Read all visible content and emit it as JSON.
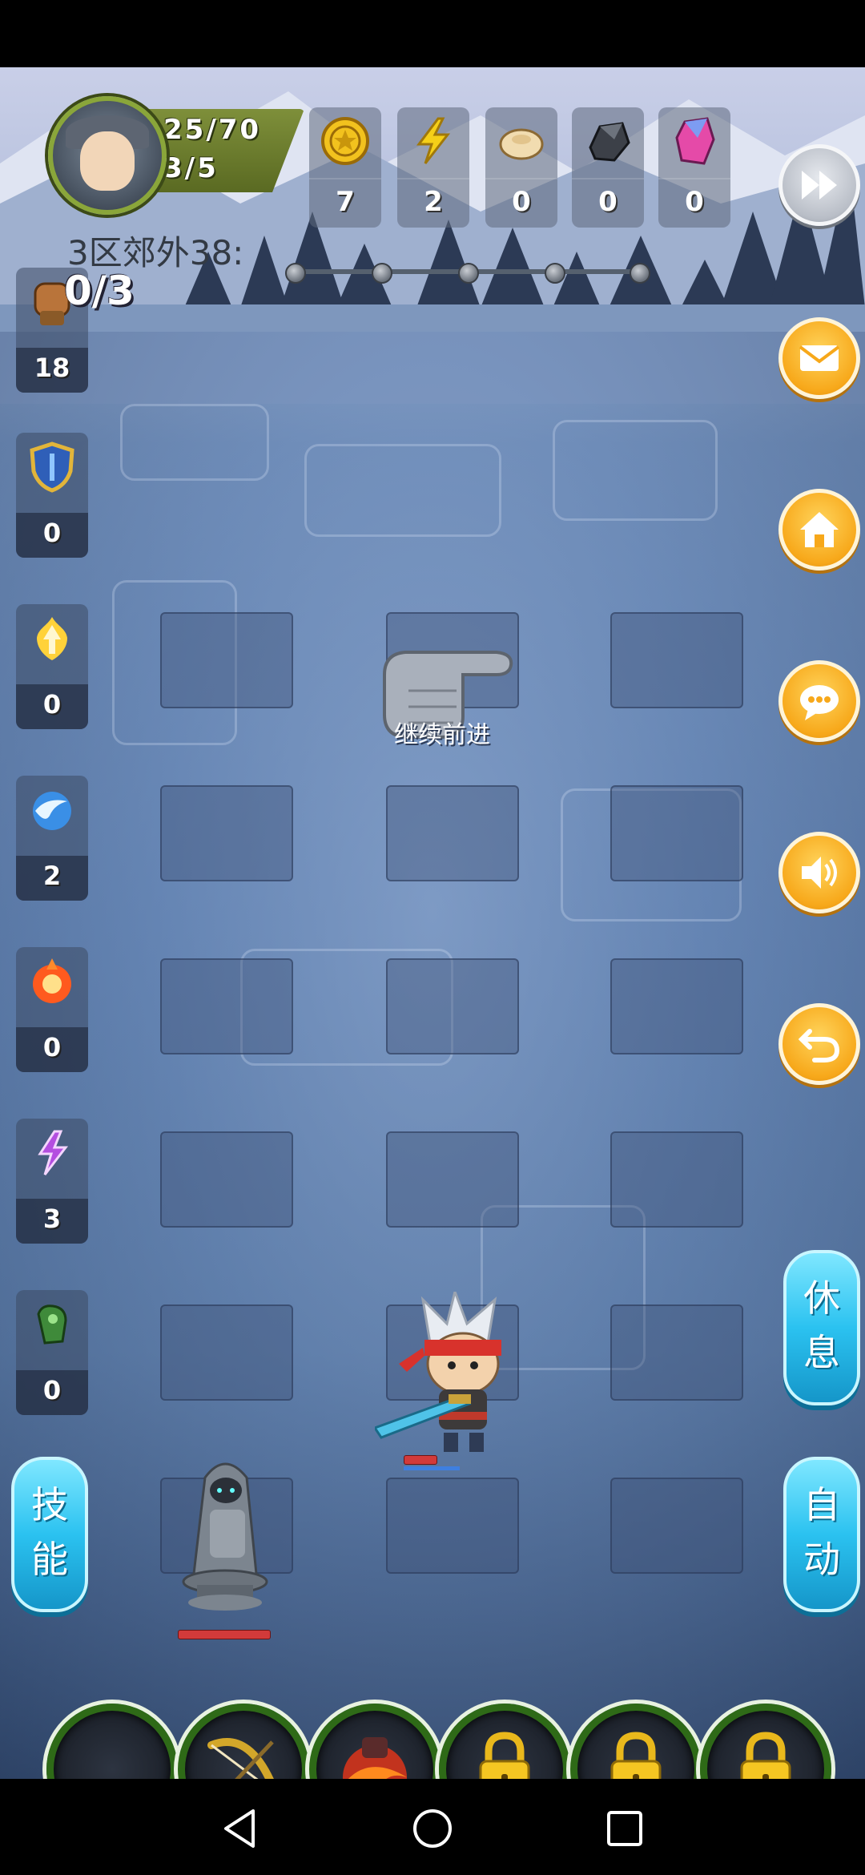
{
  "player": {
    "hp": "25/70",
    "stamina": "3/5"
  },
  "resources": [
    {
      "name": "gold-coin",
      "count": "7"
    },
    {
      "name": "lightning",
      "count": "2"
    },
    {
      "name": "dumpling",
      "count": "0"
    },
    {
      "name": "iron-ore",
      "count": "0"
    },
    {
      "name": "crystal",
      "count": "0"
    }
  ],
  "stage": {
    "label": "3区郊外38:",
    "kills": "0/3",
    "progress_steps": 5
  },
  "items": [
    {
      "name": "fist",
      "count": "18"
    },
    {
      "name": "shield",
      "count": "0"
    },
    {
      "name": "holy-arrow",
      "count": "0"
    },
    {
      "name": "water-orb",
      "count": "2"
    },
    {
      "name": "fire-orb",
      "count": "0"
    },
    {
      "name": "lightning-rune",
      "count": "3"
    },
    {
      "name": "green-gauntlet",
      "count": "0"
    }
  ],
  "side_buttons": [
    "fast-forward",
    "mail",
    "home",
    "chat",
    "sound",
    "back"
  ],
  "actions": {
    "rest": "休息",
    "auto": "自动",
    "skill": "技能"
  },
  "hint": "继续前进",
  "skills": [
    {
      "name": "empty"
    },
    {
      "name": "bow"
    },
    {
      "name": "fire-strike"
    },
    {
      "name": "locked"
    },
    {
      "name": "locked"
    },
    {
      "name": "locked"
    }
  ],
  "colors": {
    "accent_orange": "#f7a81a",
    "accent_blue": "#2bc2f0",
    "skill_ring": "#2e6a17"
  }
}
